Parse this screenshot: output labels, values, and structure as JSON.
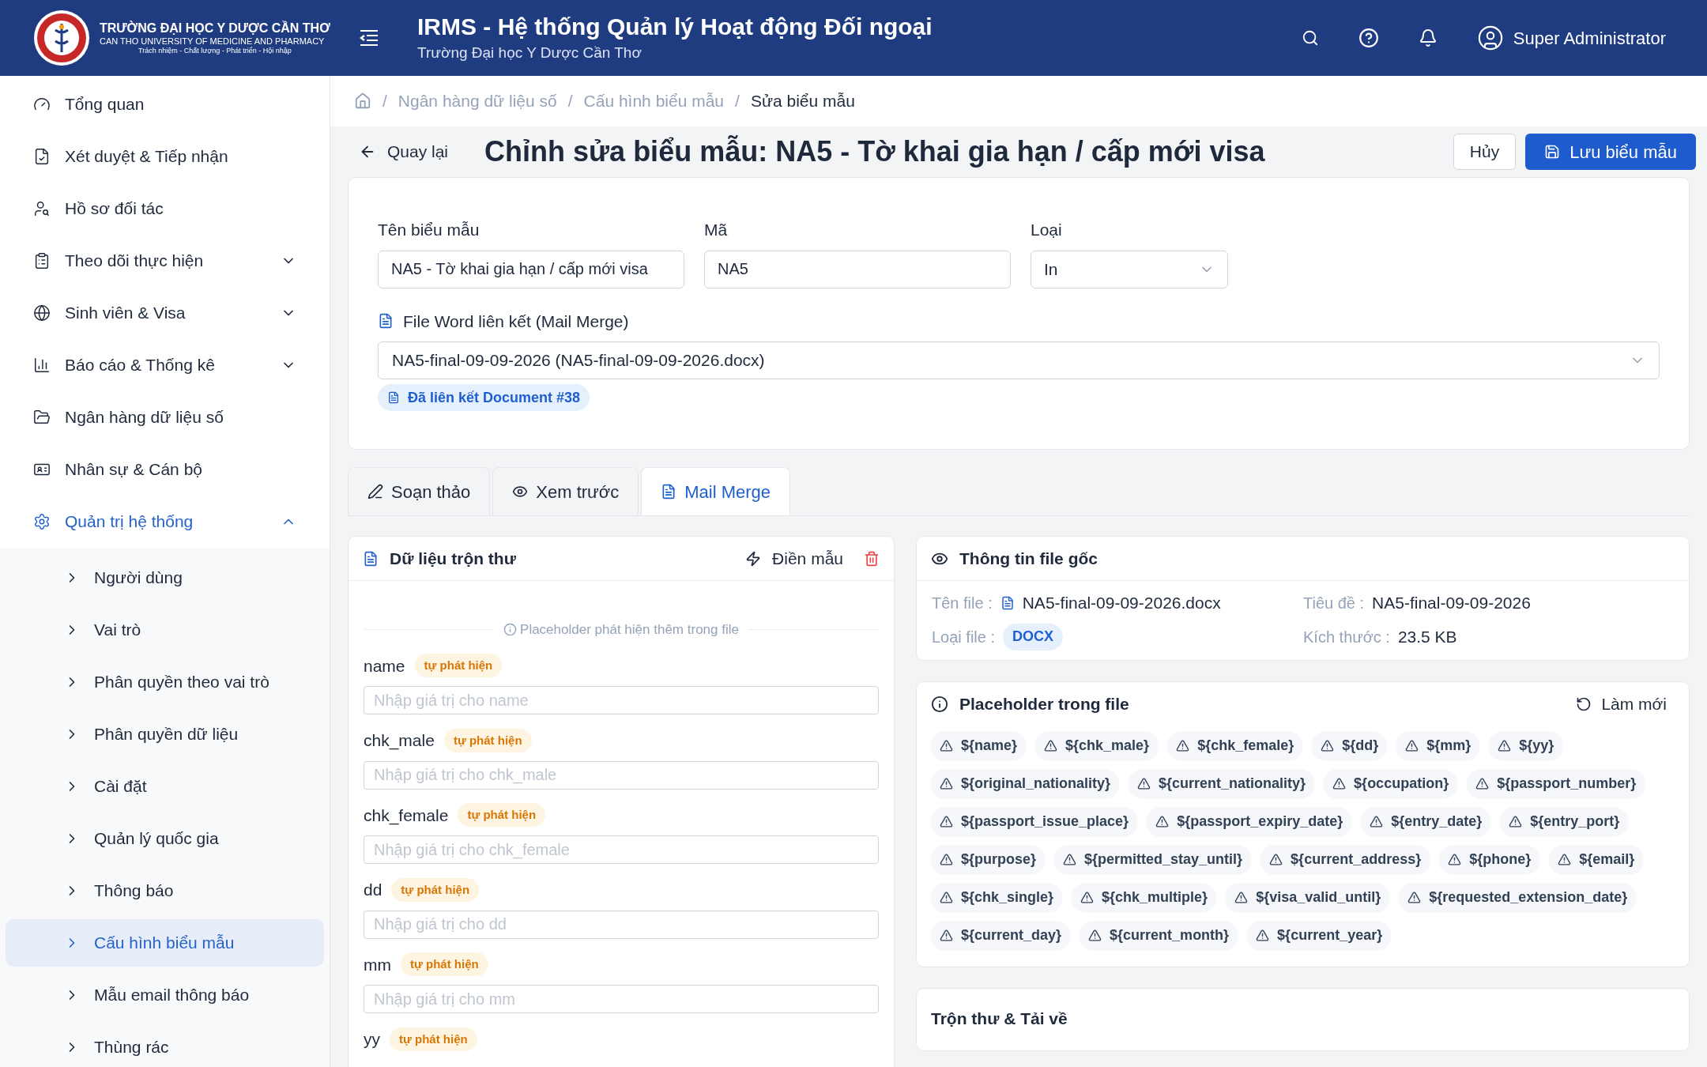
{
  "header": {
    "logo_title": "TRƯỜNG ĐẠI HỌC Y DƯỢC CẦN THƠ",
    "logo_subtitle": "CAN THO UNIVERSITY OF MEDICINE AND PHARMACY",
    "logo_motto": "Trách nhiệm - Chất lượng - Phát triển - Hội nhập",
    "app_title": "IRMS - Hệ thống Quản lý Hoạt động Đối ngoại",
    "app_subtitle": "Trường Đại học Y Dược Cần Thơ",
    "user_name": "Super Administrator"
  },
  "sidebar": {
    "items": [
      {
        "label": "Tổng quan",
        "selected": false
      },
      {
        "label": "Xét duyệt & Tiếp nhận",
        "selected": false
      },
      {
        "label": "Hồ sơ đối tác",
        "selected": false
      },
      {
        "label": "Theo dõi thực hiện",
        "selected": false,
        "expanded": false
      },
      {
        "label": "Sinh viên & Visa",
        "selected": false,
        "expanded": false
      },
      {
        "label": "Báo cáo & Thống kê",
        "selected": false,
        "expanded": false
      },
      {
        "label": "Ngân hàng dữ liệu số",
        "selected": false
      },
      {
        "label": "Nhân sự & Cán bộ",
        "selected": false
      },
      {
        "label": "Quản trị hệ thống",
        "selected": true,
        "expanded": true,
        "children": [
          {
            "label": "Người dùng",
            "selected": false
          },
          {
            "label": "Vai trò",
            "selected": false
          },
          {
            "label": "Phân quyền theo vai trò",
            "selected": false
          },
          {
            "label": "Phân quyền dữ liệu",
            "selected": false
          },
          {
            "label": "Cài đặt",
            "selected": false
          },
          {
            "label": "Quản lý quốc gia",
            "selected": false
          },
          {
            "label": "Thông báo",
            "selected": false
          },
          {
            "label": "Cấu hình biểu mẫu",
            "selected": true
          },
          {
            "label": "Mẫu email thông báo",
            "selected": false
          },
          {
            "label": "Thùng rác",
            "selected": false
          }
        ]
      }
    ]
  },
  "breadcrumb": {
    "separator": "/",
    "items": [
      "Ngân hàng dữ liệu số",
      "Cấu hình biểu mẫu",
      "Sửa biểu mẫu"
    ]
  },
  "page": {
    "back_label": "Quay lại",
    "title": "Chỉnh sửa biểu mẫu: NA5 - Tờ khai gia hạn / cấp mới visa",
    "cancel_label": "Hủy",
    "save_label": "Lưu biểu mẫu"
  },
  "form": {
    "fields": [
      {
        "label": "Tên biểu mẫu",
        "value": "NA5 - Tờ khai gia hạn / cấp mới visa",
        "kind": "text"
      },
      {
        "label": "Mã",
        "value": "NA5",
        "kind": "text"
      },
      {
        "label": "Loại",
        "value": "In",
        "kind": "select"
      }
    ],
    "file_label": "File Word liên kết (Mail Merge)",
    "file_value": "NA5-final-09-09-2026 (NA5-final-09-09-2026.docx)",
    "linked_badge": "Đã liên kết Document #38"
  },
  "tabs": [
    {
      "label": "Soạn thảo",
      "selected": false
    },
    {
      "label": "Xem trước",
      "selected": false
    },
    {
      "label": "Mail Merge",
      "selected": true
    }
  ],
  "merge_panel": {
    "title": "Dữ liệu trộn thư",
    "fill_label": "Điền mẫu",
    "divider_text": "Placeholder phát hiện thêm trong file",
    "fields": [
      {
        "name": "name",
        "badge": "tự phát hiện",
        "placeholder": "Nhập giá trị cho name"
      },
      {
        "name": "chk_male",
        "badge": "tự phát hiện",
        "placeholder": "Nhập giá trị cho chk_male"
      },
      {
        "name": "chk_female",
        "badge": "tự phát hiện",
        "placeholder": "Nhập giá trị cho chk_female"
      },
      {
        "name": "dd",
        "badge": "tự phát hiện",
        "placeholder": "Nhập giá trị cho dd"
      },
      {
        "name": "mm",
        "badge": "tự phát hiện",
        "placeholder": "Nhập giá trị cho mm"
      },
      {
        "name": "yy",
        "badge": "tự phát hiện"
      }
    ]
  },
  "file_info": {
    "title": "Thông tin file gốc",
    "name_label": "Tên file :",
    "name_value": "NA5-final-09-09-2026.docx",
    "title_label": "Tiêu đề :",
    "title_value": "NA5-final-09-09-2026",
    "type_label": "Loại file :",
    "type_value": "DOCX",
    "size_label": "Kích thước :",
    "size_value": "23.5 KB"
  },
  "placeholders": {
    "title": "Placeholder trong file",
    "refresh_label": "Làm mới",
    "tags": [
      "${name}",
      "${chk_male}",
      "${chk_female}",
      "${dd}",
      "${mm}",
      "${yy}",
      "${original_nationality}",
      "${current_nationality}",
      "${occupation}",
      "${passport_number}",
      "${passport_issue_place}",
      "${passport_expiry_date}",
      "${entry_date}",
      "${entry_port}",
      "${purpose}",
      "${permitted_stay_until}",
      "${current_address}",
      "${phone}",
      "${email}",
      "${chk_single}",
      "${chk_multiple}",
      "${visa_valid_until}",
      "${requested_extension_date}",
      "${current_day}",
      "${current_month}",
      "${current_year}"
    ]
  },
  "next_panel": {
    "title": "Trộn thư & Tải về"
  }
}
